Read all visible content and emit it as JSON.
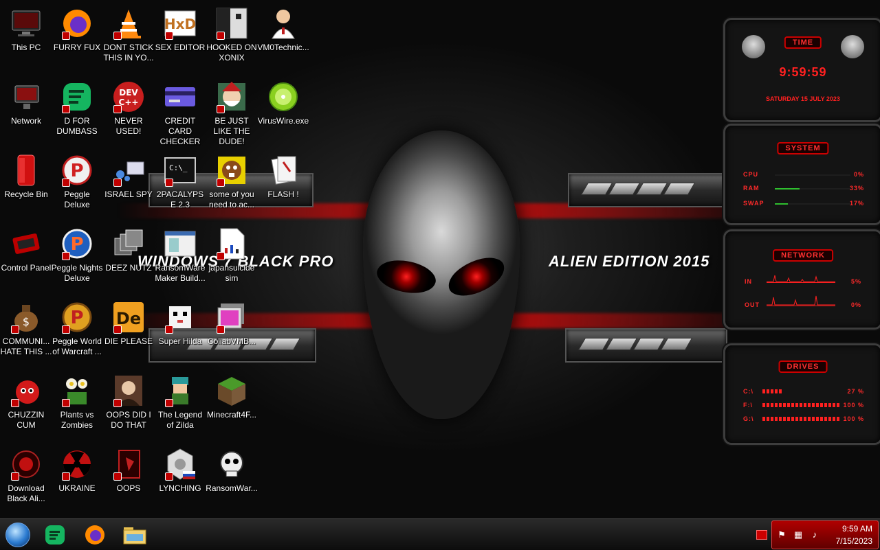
{
  "wallpaper": {
    "left_text": "WINDOWS 7 BLACK PRO",
    "right_text": "ALIEN EDITION 2015"
  },
  "icons": {
    "this_pc": "This PC",
    "furry_fux": "FURRY FUX",
    "dont_stick": "DONT STICK THIS IN YO...",
    "sex_editor": "SEX EDITOR",
    "hooked_on_xonix": "HOOKED ON XONIX",
    "vm0technic": "VM0Technic...",
    "network": "Network",
    "d_for_dumbass": "D FOR DUMBASS",
    "never_used": "NEVER USED!",
    "credit_card_checker": "CREDIT CARD CHECKER",
    "be_just_like": "BE JUST LIKE THE DUDE!",
    "viruswire": "VirusWire.exe",
    "recycle_bin": "Recycle Bin",
    "peggle_deluxe": "Peggle Deluxe",
    "israel_spy": "ISRAEL SPY",
    "pacalypse": "2PACALYPSE 2.3",
    "some_of_you": "some of you need to ac...",
    "flash": "FLASH !",
    "control_panel": "Control Panel",
    "peggle_nights": "Peggle Nights Deluxe",
    "deez_nuts": "DEEZ NUTZ",
    "ransomware_maker": "RansomWare Maker Build...",
    "japansuicide": "japansuicide sim",
    "communi": "COMMUNI... HATE THIS ...",
    "peggle_world": "Peggle World of Warcraft ...",
    "die_please": "DIE PLEASE",
    "super_hilda": "Super Hilda",
    "collabvm": "CollabVMB...",
    "chuzzin": "CHUZZIN CUM",
    "plants_vs_zombies": "Plants vs Zombies",
    "oops_did_i": "OOPS DID I DO THAT",
    "legend_of_zilda": "The Legend of Zilda",
    "minecraft": "Minecraft4F...",
    "download_black": "Download Black Ali...",
    "ukraine": "UKRAINE",
    "oops": "OOPS",
    "lynching": "LYNCHING",
    "ransomwar": "RansomWar..."
  },
  "gadgets": {
    "time": {
      "header": "TIME",
      "clock": "9:59:59",
      "date": "SATURDAY 15 JULY 2023"
    },
    "system": {
      "header": "SYSTEM",
      "rows": [
        {
          "label": "CPU",
          "value": "0%",
          "level": 0
        },
        {
          "label": "RAM",
          "value": "33%",
          "level": 33
        },
        {
          "label": "SWAP",
          "value": "17%",
          "level": 17
        }
      ]
    },
    "network": {
      "header": "NETWORK",
      "rows": [
        {
          "label": "IN",
          "value": "5%"
        },
        {
          "label": "OUT",
          "value": "0%"
        }
      ]
    },
    "drives": {
      "header": "DRIVES",
      "rows": [
        {
          "label": "C:\\",
          "value": "27 %",
          "level": 27
        },
        {
          "label": "F:\\",
          "value": "100 %",
          "level": 100
        },
        {
          "label": "G:\\",
          "value": "100 %",
          "level": 100
        }
      ]
    }
  },
  "taskbar": {
    "clock_time": "9:59 AM",
    "clock_date": "7/15/2023"
  },
  "colors": {
    "accent_red": "#c00000",
    "gadget_text": "#ff2a2a",
    "meter_green": "#2fbf2f"
  }
}
